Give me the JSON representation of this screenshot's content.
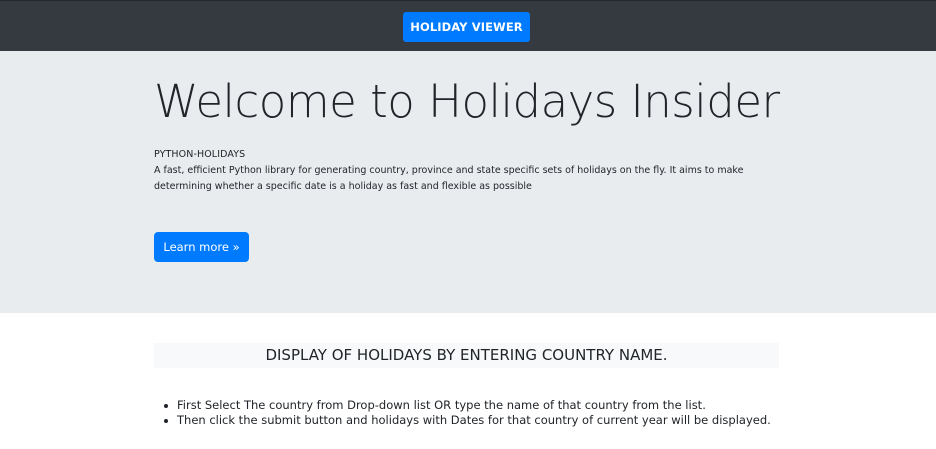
{
  "navbar": {
    "brand_label": "HOLIDAY VIEWER"
  },
  "hero": {
    "title": "Welcome to Holidays Insider",
    "library_name": "PYTHON-HOLIDAYS",
    "description": "A fast, efficient Python library for generating country, province and state specific sets of holidays on the fly. It aims to make determining whether a specific date is a holiday as fast and flexible as possible",
    "learn_more_label": "Learn more »"
  },
  "main": {
    "section_title": "DISPLAY OF HOLIDAYS BY ENTERING COUNTRY NAME.",
    "instructions": [
      "First Select The country from Drop-down list OR type the name of that country from the list.",
      "Then click the submit button and holidays with Dates for that country of current year will be displayed."
    ]
  },
  "colors": {
    "navbar_bg": "#343a40",
    "accent": "#007bff",
    "jumbotron_bg": "#e9ecef",
    "section_title_bg": "#f8f9fa",
    "text": "#212529"
  }
}
